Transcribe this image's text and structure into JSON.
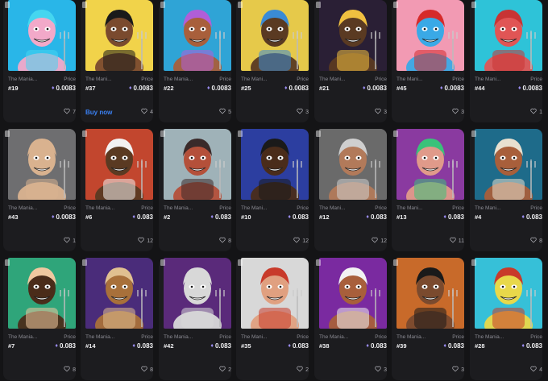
{
  "labels": {
    "price": "Price",
    "buy_now": "Buy now"
  },
  "cards": [
    {
      "collection": "The Mania...",
      "token": "#19",
      "price": "0.0083",
      "likes": "7",
      "bg": "#29b6e8",
      "skin": "#f2a9c9",
      "hair": "#45d6f0",
      "show_buy": false
    },
    {
      "collection": "The Mani...",
      "token": "#37",
      "price": "0.0083",
      "likes": "4",
      "bg": "#f1d34a",
      "skin": "#7a4a2e",
      "hair": "#1a1a1a",
      "show_buy": true
    },
    {
      "collection": "The Mania...",
      "token": "#22",
      "price": "0.0083",
      "likes": "5",
      "bg": "#2fa4d6",
      "skin": "#a85f3b",
      "hair": "#b05ed8",
      "show_buy": false
    },
    {
      "collection": "The Mani...",
      "token": "#25",
      "price": "0.0083",
      "likes": "3",
      "bg": "#e6c94a",
      "skin": "#5a3a22",
      "hair": "#3a8bd6",
      "show_buy": false
    },
    {
      "collection": "The Mani...",
      "token": "#21",
      "price": "0.0083",
      "likes": "3",
      "bg": "#2a1f35",
      "skin": "#5a3a22",
      "hair": "#f0c040",
      "show_buy": false
    },
    {
      "collection": "The Mani...",
      "token": "#45",
      "price": "0.0083",
      "likes": "3",
      "bg": "#f29ab3",
      "skin": "#3aa9e6",
      "hair": "#d62a2a",
      "show_buy": false
    },
    {
      "collection": "The Mani...",
      "token": "#44",
      "price": "0.0083",
      "likes": "1",
      "bg": "#2ec3d8",
      "skin": "#e05555",
      "hair": "#c83434",
      "show_buy": false
    },
    {
      "collection": "The Mania...",
      "token": "#43",
      "price": "0.0083",
      "likes": "1",
      "bg": "#6e6e70",
      "skin": "#d9b28f",
      "hair": "#d9b28f",
      "show_buy": false
    },
    {
      "collection": "The Mania...",
      "token": "#6",
      "price": "0.083",
      "likes": "12",
      "bg": "#c2462e",
      "skin": "#5a3a22",
      "hair": "#f2f2f2",
      "show_buy": false
    },
    {
      "collection": "The Mania...",
      "token": "#2",
      "price": "0.083",
      "likes": "8",
      "bg": "#9fb2b8",
      "skin": "#b4503a",
      "hair": "#3a2a2a",
      "show_buy": false
    },
    {
      "collection": "The Mani...",
      "token": "#10",
      "price": "0.083",
      "likes": "12",
      "bg": "#2c3ea0",
      "skin": "#4a2c1a",
      "hair": "#1a1a1a",
      "show_buy": false
    },
    {
      "collection": "The Mani...",
      "token": "#12",
      "price": "0.083",
      "likes": "12",
      "bg": "#6a6a6a",
      "skin": "#b27a5a",
      "hair": "#cfcfcf",
      "show_buy": false
    },
    {
      "collection": "The Mani...",
      "token": "#13",
      "price": "0.083",
      "likes": "11",
      "bg": "#8a3aa0",
      "skin": "#e09a8a",
      "hair": "#3ac27a",
      "show_buy": false
    },
    {
      "collection": "The Mani...",
      "token": "#4",
      "price": "0.083",
      "likes": "8",
      "bg": "#1e6b8a",
      "skin": "#a85f3b",
      "hair": "#e8e0d0",
      "show_buy": false
    },
    {
      "collection": "The Mania...",
      "token": "#7",
      "price": "0.083",
      "likes": "8",
      "bg": "#2fa57a",
      "skin": "#4a2c1a",
      "hair": "#f0c8a0",
      "show_buy": false
    },
    {
      "collection": "The Mania...",
      "token": "#14",
      "price": "0.083",
      "likes": "8",
      "bg": "#4a2c7a",
      "skin": "#a8703a",
      "hair": "#e0c090",
      "show_buy": false
    },
    {
      "collection": "The Mania...",
      "token": "#42",
      "price": "0.083",
      "likes": "2",
      "bg": "#5a2a7a",
      "skin": "#d8d8d8",
      "hair": "#d8d8d8",
      "show_buy": false
    },
    {
      "collection": "The Mani...",
      "token": "#35",
      "price": "0.083",
      "likes": "2",
      "bg": "#d8d8d8",
      "skin": "#e0a080",
      "hair": "#c83a2a",
      "show_buy": false
    },
    {
      "collection": "The Mania...",
      "token": "#38",
      "price": "0.083",
      "likes": "3",
      "bg": "#7a2aa0",
      "skin": "#a85f3b",
      "hair": "#f2f2f2",
      "show_buy": false
    },
    {
      "collection": "The Mania...",
      "token": "#39",
      "price": "0.083",
      "likes": "3",
      "bg": "#c86a2a",
      "skin": "#7a4a2e",
      "hair": "#1a1a1a",
      "show_buy": false
    },
    {
      "collection": "The Mania...",
      "token": "#28",
      "price": "0.083",
      "likes": "4",
      "bg": "#36c0d8",
      "skin": "#e8d84a",
      "hair": "#c83a2a",
      "show_buy": false
    }
  ]
}
